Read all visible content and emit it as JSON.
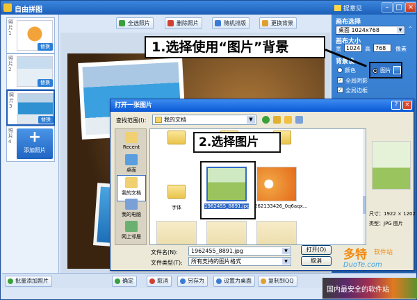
{
  "window": {
    "title": "自由拼图",
    "feedback": "提意见"
  },
  "thumbnails": [
    {
      "num": "照片1",
      "replace": "替换"
    },
    {
      "num": "照片2",
      "replace": "替换"
    },
    {
      "num": "照片3",
      "replace": "替换"
    },
    {
      "num": "照片4",
      "add": "添加照片"
    }
  ],
  "toolbar": {
    "select_all": "全选照片",
    "delete": "删除照片",
    "random": "随机排版",
    "change_bg": "更换背景"
  },
  "panel": {
    "canvas_select": "画布选择",
    "canvas_value": "桌面 1024x768",
    "canvas_size": "画布大小",
    "width_label": "宽",
    "width": "1024",
    "height_label": "高",
    "height": "768",
    "unit": "像素",
    "background": "背景设",
    "color_option": "颜色",
    "picture_option": "图片",
    "full_shadow": "全局阴影",
    "full_border": "全局边框"
  },
  "annotations": {
    "step1": "1.选择使用“图片”背景",
    "step2": "2.选择图片"
  },
  "dialog": {
    "title": "打开一张图片",
    "look_in_label": "查找范围(I):",
    "look_in_value": "我的文档",
    "places": [
      "Recent",
      "桌面",
      "我的文档",
      "我的电脑",
      "网上邻居"
    ],
    "files": [
      {
        "name": "",
        "type": "folder"
      },
      {
        "name": "",
        "type": "folder"
      },
      {
        "name": "",
        "type": "folder"
      },
      {
        "name": "字体",
        "type": "folder"
      },
      {
        "name": "1962455_8891.jpg",
        "type": "image",
        "selected": true
      },
      {
        "name": "262133426_0q6aqx...",
        "type": "image"
      }
    ],
    "preview_size_label": "尺寸：",
    "preview_size": "1922 × 1202",
    "preview_type_label": "类型：",
    "preview_type": "JPG 图片",
    "filename_label": "文件名(N):",
    "filename_value": "1962455_8891.jpg",
    "filetype_label": "文件类型(T):",
    "filetype_value": "所有支持的图片格式",
    "open": "打开(O)",
    "cancel": "取消"
  },
  "bottombar": {
    "batch_add": "批量添加照片",
    "confirm": "确定",
    "cancel": "取消",
    "save_as": "另存为",
    "set_desktop": "设置为桌面",
    "copy_qq": "复制到QQ"
  },
  "watermark": {
    "brand": "多特",
    "sub": "软件站",
    "url": "DuoTe.com",
    "slogan": "国内最安全的软件站"
  },
  "colors": {
    "title": "#1c5fb8",
    "panel": "#2a6cc0",
    "accent": "#f08a10"
  }
}
